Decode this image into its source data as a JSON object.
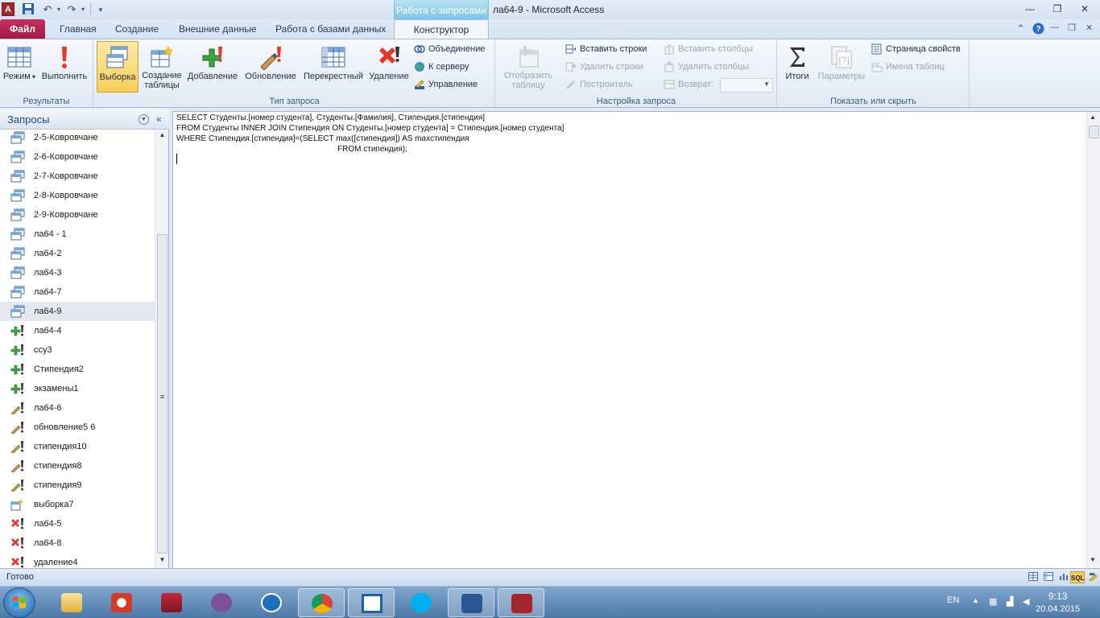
{
  "titlebar": {
    "app_logo": "A",
    "context_tab_group": "Работа с запросами",
    "window_title": "ла64-9  -  Microsoft Access",
    "minimize": "—",
    "maximize": "❐",
    "close": "✕"
  },
  "tabs": {
    "file": "Файл",
    "items": [
      "Главная",
      "Создание",
      "Внешние данные",
      "Работа с базами данных",
      "Конструктор"
    ]
  },
  "ribbon": {
    "results": {
      "label": "Результаты",
      "mode": "Режим",
      "run": "Выполнить"
    },
    "query_type": {
      "label": "Тип запроса",
      "select": "Выборка",
      "make_table_1": "Создание",
      "make_table_2": "таблицы",
      "append": "Добавление",
      "update": "Обновление",
      "crosstab": "Перекрестный",
      "delete": "Удаление",
      "union": "Объединение",
      "pass_through": "К серверу",
      "data_definition": "Управление"
    },
    "query_setup": {
      "label": "Настройка запроса",
      "show_table_1": "Отобразить",
      "show_table_2": "таблицу",
      "insert_rows": "Вставить строки",
      "delete_rows": "Удалить строки",
      "builder": "Построитель",
      "insert_columns": "Вставить столбцы",
      "delete_columns": "Удалить столбцы",
      "return": "Возврат:",
      "return_value": ""
    },
    "show_hide": {
      "label": "Показать или скрыть",
      "totals": "Итоги",
      "parameters": "Параметры",
      "property_sheet": "Страница свойств",
      "table_names": "Имена таблиц"
    }
  },
  "nav": {
    "title": "Запросы",
    "items": [
      {
        "label": "2-5-Ковровчане",
        "icon": "select-query-icon"
      },
      {
        "label": "2-6-Ковровчане",
        "icon": "select-query-icon"
      },
      {
        "label": "2-7-Ковровчане",
        "icon": "select-query-icon"
      },
      {
        "label": "2-8-Ковровчане",
        "icon": "select-query-icon"
      },
      {
        "label": "2-9-Ковровчане",
        "icon": "select-query-icon"
      },
      {
        "label": "ла64 - 1",
        "icon": "select-query-icon"
      },
      {
        "label": "ла64-2",
        "icon": "select-query-icon"
      },
      {
        "label": "ла64-3",
        "icon": "select-query-icon"
      },
      {
        "label": "ла64-7",
        "icon": "select-query-icon"
      },
      {
        "label": "ла64-9",
        "icon": "select-query-icon",
        "selected": true
      },
      {
        "label": "ла64-4",
        "icon": "append-query-icon"
      },
      {
        "label": "ccy3",
        "icon": "append-query-icon"
      },
      {
        "label": "Стипендия2",
        "icon": "append-query-icon"
      },
      {
        "label": "экзамены1",
        "icon": "append-query-icon"
      },
      {
        "label": "ла64-6",
        "icon": "update-query-icon"
      },
      {
        "label": "обновление5 6",
        "icon": "update-query-icon"
      },
      {
        "label": "стипендия10",
        "icon": "update-query-icon"
      },
      {
        "label": "стипендия8",
        "icon": "update-query-icon"
      },
      {
        "label": "стипендия9",
        "icon": "update-query-icon"
      },
      {
        "label": "выборка7",
        "icon": "make-table-query-icon"
      },
      {
        "label": "ла64-5",
        "icon": "delete-query-icon"
      },
      {
        "label": "ла64-8",
        "icon": "delete-query-icon"
      },
      {
        "label": "удаление4",
        "icon": "delete-query-icon"
      }
    ]
  },
  "editor": {
    "lines": [
      "SELECT Студенты.[номер студента], Студенты.[Фамилия], Стипендия.[стипендия]",
      "FROM Студенты INNER JOIN Стипендия ON Студенты.[номер студента] = Стипендия.[номер студента]",
      "WHERE Стипендия.[стипендия]=(SELECT max([стипендия]) AS maxстипендия",
      "                                                                        FROM стипендия);"
    ]
  },
  "statusbar": {
    "text": "Готово",
    "sql_view": "SQL"
  },
  "taskbar": {
    "lang": "EN",
    "time": "9:13",
    "date": "20.04.2015"
  },
  "colors": {
    "file_tab": "#a41b44",
    "context_tab": "#79c6e6",
    "selected_button": "#f9cf5a"
  }
}
